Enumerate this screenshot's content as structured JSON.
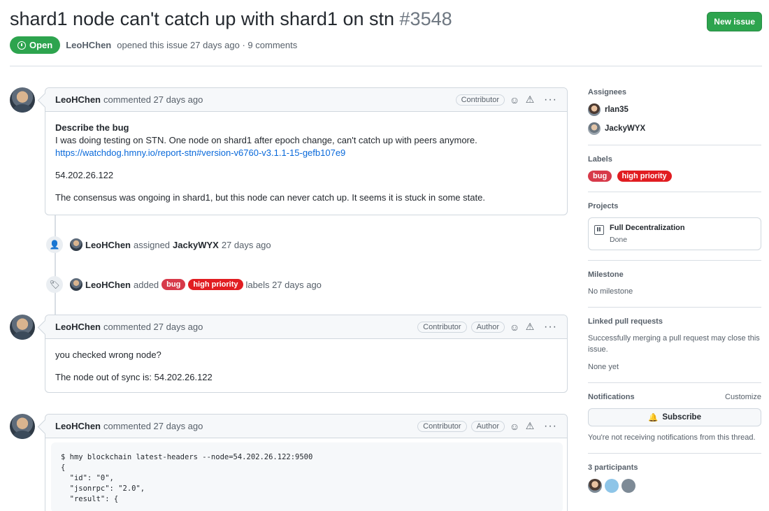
{
  "issue": {
    "title": "shard1 node can't catch up with shard1 on stn",
    "number": "#3548",
    "new_issue_label": "New issue",
    "state": "Open",
    "author": "LeoHChen",
    "meta": "opened this issue 27 days ago · 9 comments"
  },
  "comments": [
    {
      "author": "LeoHChen",
      "time": "commented 27 days ago",
      "roles": [
        "Contributor"
      ],
      "heading": "Describe the bug",
      "line1": "I was doing testing on STN. One node on shard1 after epoch change, can't catch up with peers anymore.",
      "link": "https://watchdog.hmny.io/report-stn#version-v6760-v3.1.1-15-gefb107e9",
      "ip": "54.202.26.122",
      "para": "The consensus was ongoing in shard1, but this node can never catch up. It seems it is stuck in some state."
    },
    {
      "author": "LeoHChen",
      "time": "commented 27 days ago",
      "roles": [
        "Contributor",
        "Author"
      ],
      "line1": "you checked wrong node?",
      "line2": "The node out of sync is: 54.202.26.122"
    },
    {
      "author": "LeoHChen",
      "time": "commented 27 days ago",
      "roles": [
        "Contributor",
        "Author"
      ],
      "code": "$ hmy blockchain latest-headers --node=54.202.26.122:9500\n{\n  \"id\": \"0\",\n  \"jsonrpc\": \"2.0\",\n  \"result\": {"
    }
  ],
  "events": [
    {
      "actor": "LeoHChen",
      "action": "assigned",
      "target": "JackyWYX",
      "time": "27 days ago"
    },
    {
      "actor": "LeoHChen",
      "action": "added",
      "labels": [
        "bug",
        "high priority"
      ],
      "suffix": "labels 27 days ago"
    }
  ],
  "sidebar": {
    "assignees_title": "Assignees",
    "assignees": [
      "rlan35",
      "JackyWYX"
    ],
    "labels_title": "Labels",
    "labels": [
      {
        "name": "bug",
        "color": "#d73a4a"
      },
      {
        "name": "high priority",
        "color": "#e11d21"
      }
    ],
    "projects_title": "Projects",
    "project_name": "Full Decentralization",
    "project_status": "Done",
    "milestone_title": "Milestone",
    "milestone_value": "No milestone",
    "linked_title": "Linked pull requests",
    "linked_desc": "Successfully merging a pull request may close this issue.",
    "linked_value": "None yet",
    "notifications_title": "Notifications",
    "customize_label": "Customize",
    "subscribe_label": "Subscribe",
    "notifications_desc": "You're not receiving notifications from this thread.",
    "participants_title": "3 participants"
  }
}
